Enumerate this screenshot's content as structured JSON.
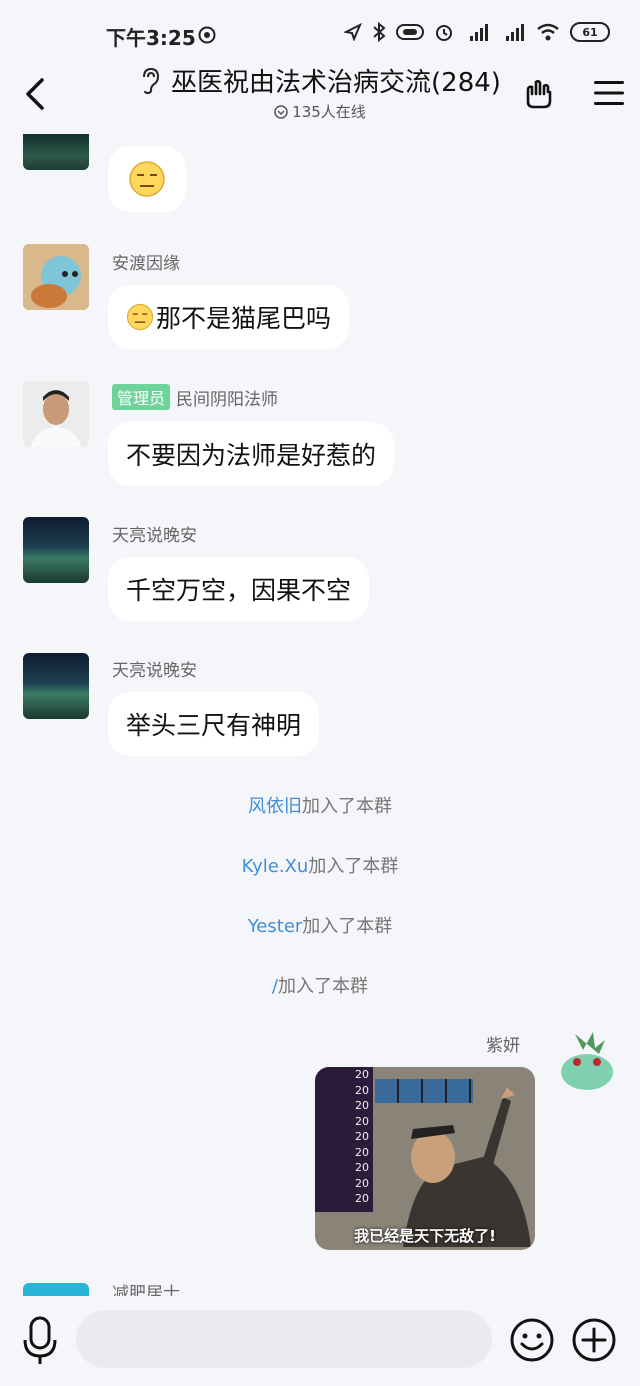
{
  "status_bar": {
    "time": "下午3:25",
    "battery": "61"
  },
  "header": {
    "title": "巫医祝由法术治病交流(284)",
    "online": "135人在线"
  },
  "messages": [
    {
      "type": "emoji",
      "sender": ""
    },
    {
      "sender": "安渡因缘",
      "text": "那不是猫尾巴吗"
    },
    {
      "sender": "民间阴阳法师",
      "badge": "管理员",
      "text": "不要因为法师是好惹的"
    },
    {
      "sender": "天亮说晚安",
      "text": "千空万空，因果不空"
    },
    {
      "sender": "天亮说晚安",
      "text": "举头三尺有神明"
    }
  ],
  "system_messages": [
    {
      "name": "风依旧",
      "suffix": "加入了本群"
    },
    {
      "name": "Kyle.Xu",
      "suffix": "加入了本群"
    },
    {
      "name": "Yester",
      "suffix": "加入了本群"
    },
    {
      "name": "/",
      "suffix": "加入了本群"
    }
  ],
  "self_message": {
    "sender": "紫妍",
    "image_caption": "我已经是天下无敌了!",
    "image_numbers": [
      "20",
      "20",
      "20",
      "20",
      "20",
      "20",
      "20",
      "20",
      "20"
    ]
  },
  "partial_next_sender": "减肥居士",
  "colors": {
    "background": "#f5f6fa",
    "bubble": "#ffffff",
    "system_name": "#3f8fd8",
    "admin_badge": "#6fd49a"
  }
}
